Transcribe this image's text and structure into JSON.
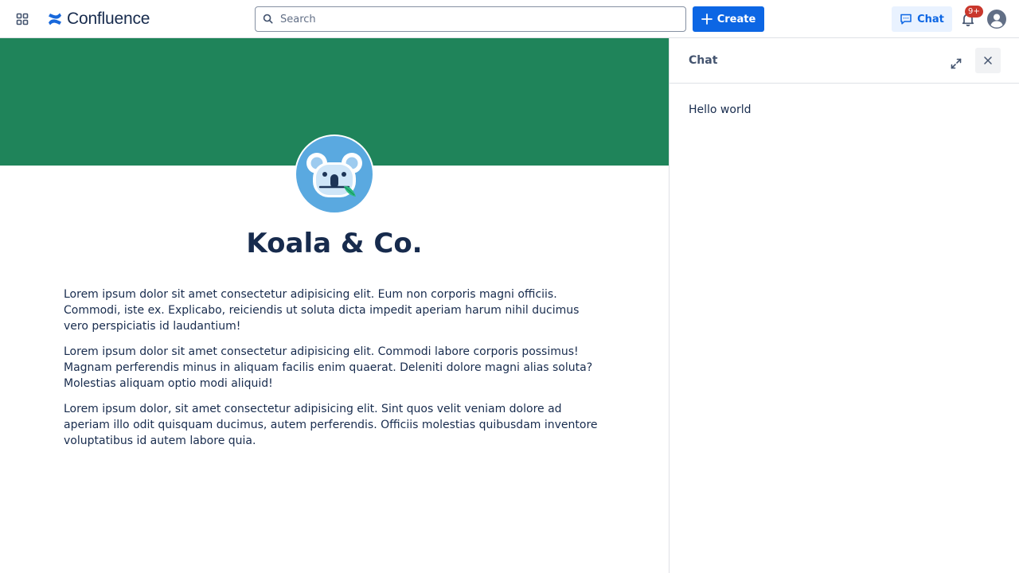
{
  "topbar": {
    "logo_text": "Confluence",
    "search_placeholder": "Search",
    "create_label": "Create",
    "chat_label": "Chat",
    "notification_badge": "9+"
  },
  "colors": {
    "brand_blue": "#0c66e4",
    "banner_green": "#1f845a",
    "badge_red": "#c9372c",
    "text_dark": "#172b4d"
  },
  "icons": {
    "apps": "app-switcher-icon",
    "search": "search-icon",
    "create": "plus-icon",
    "chat": "chat-bubble-icon",
    "notifications": "bell-icon",
    "profile": "user-avatar-icon",
    "expand": "expand-icon",
    "close": "close-icon"
  },
  "space": {
    "title": "Koala & Co.",
    "avatar": "koala-avatar",
    "paragraphs": [
      "Lorem ipsum dolor sit amet consectetur adipisicing elit. Eum non corporis magni officiis. Commodi, iste ex. Explicabo, reiciendis ut soluta dicta impedit aperiam harum nihil ducimus vero perspiciatis id laudantium!",
      "Lorem ipsum dolor sit amet consectetur adipisicing elit. Commodi labore corporis possimus! Magnam perferendis minus in aliquam facilis enim quaerat. Deleniti dolore magni alias soluta? Molestias aliquam optio modi aliquid!",
      "Lorem ipsum dolor, sit amet consectetur adipisicing elit. Sint quos velit veniam dolore ad aperiam illo odit quisquam ducimus, autem perferendis. Officiis molestias quibusdam inventore voluptatibus id autem labore quia."
    ]
  },
  "chat_panel": {
    "title": "Chat",
    "message": "Hello world"
  }
}
